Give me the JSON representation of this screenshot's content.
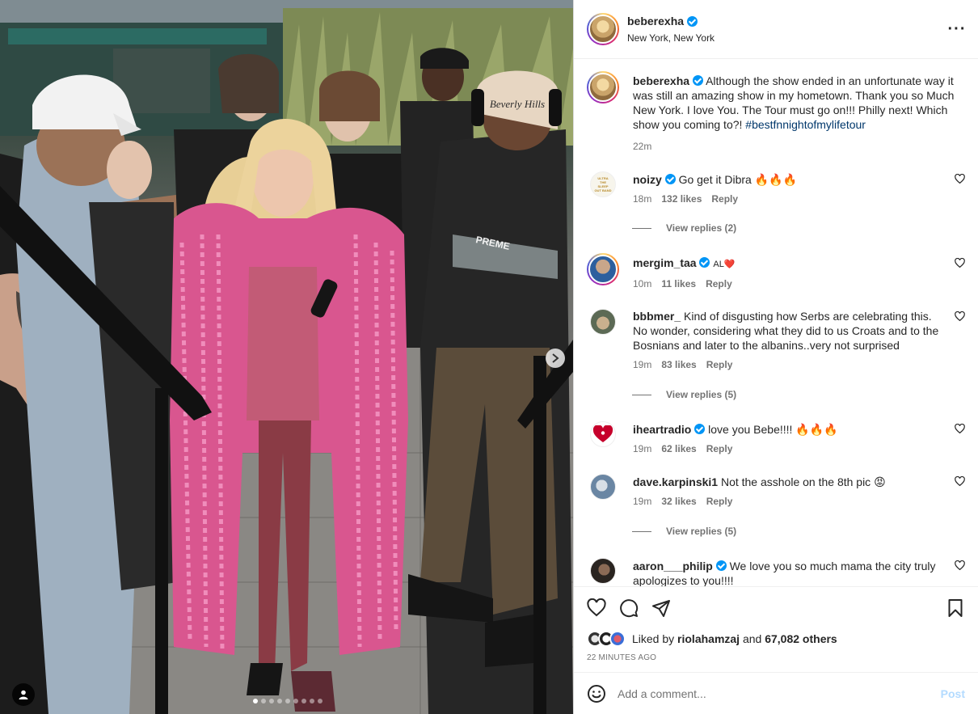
{
  "post": {
    "username": "beberexha",
    "location": "New York, New York",
    "caption": "Although the show ended in an unfortunate way it was still an amazing show in my hometown. Thank you so Much New York. I love You. The Tour must go on!!! Philly next! Which show you coming to?!",
    "hashtag": "#bestfnnightofmylifetour",
    "time_ago": "22m",
    "cap_text": "Beverly Hills",
    "bag_text": "PREME",
    "carousel_count": 9,
    "carousel_index": 1
  },
  "comments": [
    {
      "username": "noizy",
      "verified": true,
      "text": "Go get it Dibra 🔥🔥🔥",
      "time": "18m",
      "likes": "132 likes",
      "reply": "Reply",
      "view_replies": "View replies (2)",
      "avatar_text": "ULTRA THE SLEEP OUT BAND"
    },
    {
      "username": "mergim_taa",
      "verified": true,
      "text": "AL❤️",
      "time": "10m",
      "likes": "11 likes",
      "reply": "Reply"
    },
    {
      "username": "bbbmer_",
      "verified": false,
      "text": "Kind of disgusting how Serbs are celebrating this. No wonder, considering what they did to us Croats and to the Bosnians and later to the albanins..very not surprised",
      "time": "19m",
      "likes": "83 likes",
      "reply": "Reply",
      "view_replies": "View replies (5)"
    },
    {
      "username": "iheartradio",
      "verified": true,
      "text": "love you Bebe!!!! 🔥🔥🔥",
      "time": "19m",
      "likes": "62 likes",
      "reply": "Reply"
    },
    {
      "username": "dave.karpinski1",
      "verified": false,
      "text": "Not the asshole on the 8th pic 😡",
      "time": "19m",
      "likes": "32 likes",
      "reply": "Reply",
      "view_replies": "View replies (5)"
    },
    {
      "username": "aaron___philip",
      "verified": true,
      "text": "We love you so much mama the city truly apologizes to you!!!!",
      "time": "",
      "likes": "",
      "reply": ""
    }
  ],
  "liked_by": {
    "prefix": "Liked by",
    "user": "riolahamzaj",
    "middle": "and",
    "others": "67,082 others"
  },
  "timestamp": "22 MINUTES AGO",
  "add_comment": {
    "placeholder": "Add a comment...",
    "post_label": "Post"
  },
  "colors": {
    "verified": "#0095f6",
    "link": "#00376b",
    "muted": "#737373",
    "post_disabled": "#b3dbff",
    "coat": "#d9568f"
  },
  "icons": [
    "verified-badge-icon",
    "more-options-icon",
    "heart-icon",
    "comment-icon",
    "share-icon",
    "bookmark-icon",
    "emoji-icon",
    "tag-user-icon",
    "next-arrow-icon"
  ]
}
